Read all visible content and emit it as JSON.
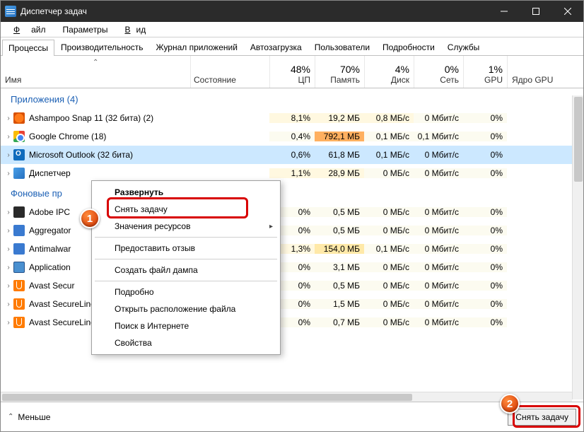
{
  "window": {
    "title": "Диспетчер задач"
  },
  "menubar": {
    "file": "Файл",
    "options": "Параметры",
    "view": "Вид"
  },
  "tabs": {
    "processes": "Процессы",
    "performance": "Производительность",
    "history": "Журнал приложений",
    "startup": "Автозагрузка",
    "users": "Пользователи",
    "details": "Подробности",
    "services": "Службы"
  },
  "columns": {
    "name": "Имя",
    "state": "Состояние",
    "cpu_pct": "48%",
    "cpu_lbl": "ЦП",
    "mem_pct": "70%",
    "mem_lbl": "Память",
    "disk_pct": "4%",
    "disk_lbl": "Диск",
    "net_pct": "0%",
    "net_lbl": "Сеть",
    "gpu_pct": "1%",
    "gpu_lbl": "GPU",
    "gpucore": "Ядро GPU"
  },
  "sections": {
    "apps": "Приложения (4)",
    "bg": "Фоновые пр"
  },
  "apps": [
    {
      "name": "Ashampoo Snap 11 (32 бита) (2)",
      "cpu": "8,1%",
      "mem": "19,2 МБ",
      "disk": "0,8 МБ/с",
      "net": "0 Мбит/с",
      "gpu": "0%",
      "icon": "ashampoo"
    },
    {
      "name": "Google Chrome (18)",
      "cpu": "0,4%",
      "mem": "792,1 МБ",
      "disk": "0,1 МБ/с",
      "net": "0,1 Мбит/с",
      "gpu": "0%",
      "icon": "chrome"
    },
    {
      "name": "Microsoft Outlook (32 бита)",
      "cpu": "0,6%",
      "mem": "61,8 МБ",
      "disk": "0,1 МБ/с",
      "net": "0 Мбит/с",
      "gpu": "0%",
      "icon": "outlook",
      "selected": true
    },
    {
      "name": "Диспетчер",
      "cpu": "1,1%",
      "mem": "28,9 МБ",
      "disk": "0 МБ/с",
      "net": "0 Мбит/с",
      "gpu": "0%",
      "icon": "tm"
    }
  ],
  "bg": [
    {
      "name": "Adobe IPC",
      "cpu": "0%",
      "mem": "0,5 МБ",
      "disk": "0 МБ/с",
      "net": "0 Мбит/с",
      "gpu": "0%",
      "icon": "adobe"
    },
    {
      "name": "Aggregator",
      "cpu": "0%",
      "mem": "0,5 МБ",
      "disk": "0 МБ/с",
      "net": "0 Мбит/с",
      "gpu": "0%",
      "icon": "agg"
    },
    {
      "name": "Antimalwar",
      "cpu": "1,3%",
      "mem": "154,0 МБ",
      "disk": "0,1 МБ/с",
      "net": "0 Мбит/с",
      "gpu": "0%",
      "icon": "shield"
    },
    {
      "name": "Application",
      "cpu": "0%",
      "mem": "3,1 МБ",
      "disk": "0 МБ/с",
      "net": "0 Мбит/с",
      "gpu": "0%",
      "icon": "svc"
    },
    {
      "name": "Avast Secur",
      "cpu": "0%",
      "mem": "0,5 МБ",
      "disk": "0 МБ/с",
      "net": "0 Мбит/с",
      "gpu": "0%",
      "icon": "avast"
    },
    {
      "name": "Avast SecureLine VPN",
      "cpu": "0%",
      "mem": "1,5 МБ",
      "disk": "0 МБ/с",
      "net": "0 Мбит/с",
      "gpu": "0%",
      "icon": "avast"
    },
    {
      "name": "Avast SecureLine VPN",
      "cpu": "0%",
      "mem": "0,7 МБ",
      "disk": "0 МБ/с",
      "net": "0 Мбит/с",
      "gpu": "0%",
      "icon": "avast"
    }
  ],
  "ctx": {
    "expand": "Развернуть",
    "end": "Снять задачу",
    "values": "Значения ресурсов",
    "feedback": "Предоставить отзыв",
    "dump": "Создать файл дампа",
    "details": "Подробно",
    "openloc": "Открыть расположение файла",
    "search": "Поиск в Интернете",
    "props": "Свойства"
  },
  "footer": {
    "less": "Меньше",
    "end": "Снять задачу"
  },
  "callouts": {
    "one": "1",
    "two": "2"
  }
}
